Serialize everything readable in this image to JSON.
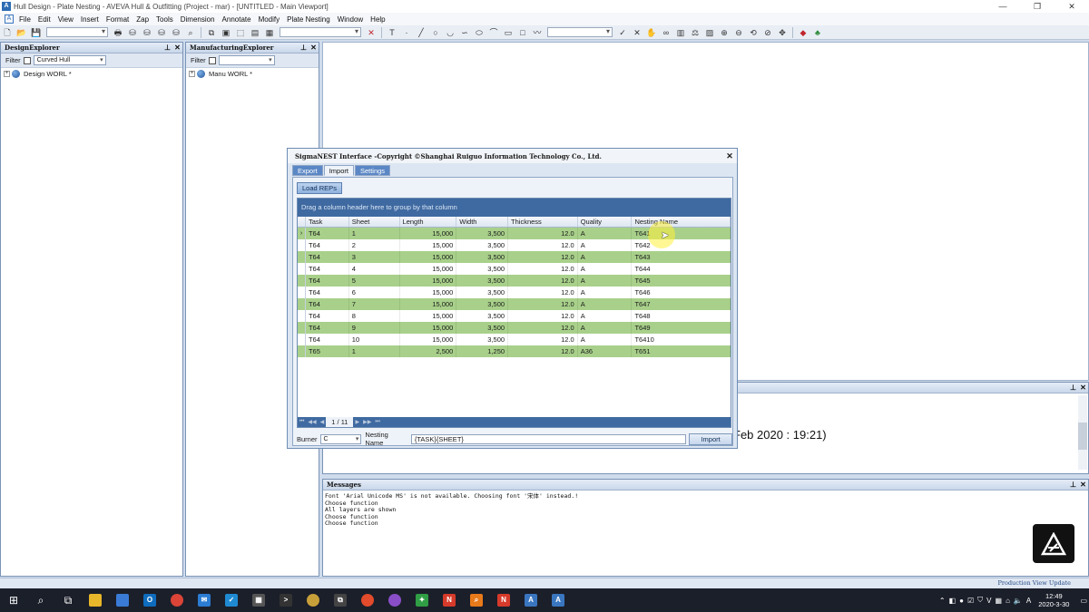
{
  "window": {
    "title": "Hull Design - Plate Nesting - AVEVA Hull & Outfitting (Project - mar) - [UNTITLED - Main Viewport]",
    "minimize": "—",
    "restore": "❐",
    "close": "✕"
  },
  "menu": [
    "File",
    "Edit",
    "View",
    "Insert",
    "Format",
    "Zap",
    "Tools",
    "Dimension",
    "Annotate",
    "Modify",
    "Plate Nesting",
    "Window",
    "Help"
  ],
  "design_explorer": {
    "title": "DesignExplorer",
    "filter_label": "Filter",
    "filter_value": "Curved Hull",
    "tree_item": "Design WORL *"
  },
  "manufacturing_explorer": {
    "title": "ManufacturingExplorer",
    "filter_label": "Filter",
    "filter_value": "",
    "tree_item": "Manu WORL *"
  },
  "dialog": {
    "title": "SigmaNEST Interface -Copyright ©Shanghai Ruiguo Information Technology Co., Ltd.",
    "tabs": [
      "Export",
      "Import",
      "Settings"
    ],
    "active_tab": "Import",
    "load_button": "Load REPs",
    "group_hint": "Drag a column header here to group by that column",
    "columns": [
      "Task",
      "Sheet",
      "Length",
      "Width",
      "Thickness",
      "Quality",
      "Nesting Name"
    ],
    "rows": [
      [
        "T64",
        "1",
        "15,000",
        "3,500",
        "12.0",
        "A",
        "T641"
      ],
      [
        "T64",
        "2",
        "15,000",
        "3,500",
        "12.0",
        "A",
        "T642"
      ],
      [
        "T64",
        "3",
        "15,000",
        "3,500",
        "12.0",
        "A",
        "T643"
      ],
      [
        "T64",
        "4",
        "15,000",
        "3,500",
        "12.0",
        "A",
        "T644"
      ],
      [
        "T64",
        "5",
        "15,000",
        "3,500",
        "12.0",
        "A",
        "T645"
      ],
      [
        "T64",
        "6",
        "15,000",
        "3,500",
        "12.0",
        "A",
        "T646"
      ],
      [
        "T64",
        "7",
        "15,000",
        "3,500",
        "12.0",
        "A",
        "T647"
      ],
      [
        "T64",
        "8",
        "15,000",
        "3,500",
        "12.0",
        "A",
        "T648"
      ],
      [
        "T64",
        "9",
        "15,000",
        "3,500",
        "12.0",
        "A",
        "T649"
      ],
      [
        "T64",
        "10",
        "15,000",
        "3,500",
        "12.0",
        "A",
        "T6410"
      ],
      [
        "T65",
        "1",
        "2,500",
        "1,250",
        "12.0",
        "A36",
        "T651"
      ]
    ],
    "pager_text": "1 / 11",
    "burner_label": "Burner",
    "burner_value": "C",
    "nesting_name_label": "Nesting Name",
    "nesting_name_value": "{TASK}{SHEET}",
    "import_button": "Import"
  },
  "output_panel": {
    "partial_text": "Feb 2020 : 19:21)"
  },
  "messages": {
    "title": "Messages",
    "lines": [
      "Font 'Arial Unicode MS' is not available. Choosing font '宋体' instead.!",
      "Choose function",
      "All layers are shown",
      "Choose function",
      "Choose function"
    ]
  },
  "status_bar": "Production View Update",
  "taskbar": {
    "time": "12:49",
    "date": "2020-3-30",
    "ime": "A"
  },
  "colors": {
    "row_green": "#a8d08a",
    "grid_header_blue": "#3f6aa1",
    "panel_border": "#7a93b6"
  }
}
